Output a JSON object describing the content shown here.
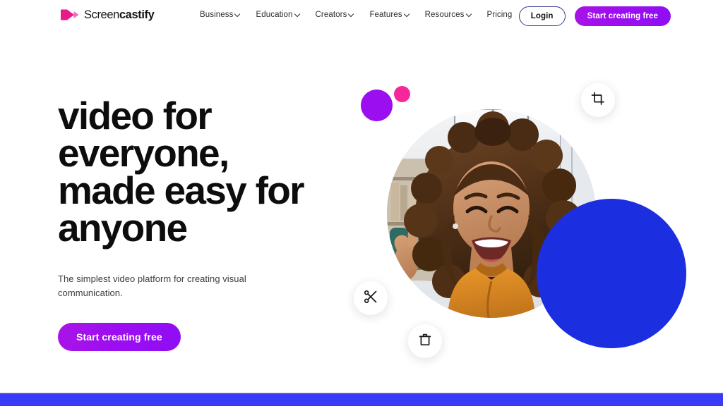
{
  "site": {
    "brand_name_light": "Screen",
    "brand_name_bold": "castify",
    "logo_icon": "play-logo-icon"
  },
  "header": {
    "nav_items": [
      {
        "label": "Business",
        "has_dropdown": true
      },
      {
        "label": "Education",
        "has_dropdown": true
      },
      {
        "label": "Creators",
        "has_dropdown": true
      },
      {
        "label": "Features",
        "has_dropdown": true
      },
      {
        "label": "Resources",
        "has_dropdown": true
      },
      {
        "label": "Pricing",
        "has_dropdown": false
      }
    ],
    "login_label": "Login",
    "cta_label": "Start creating free"
  },
  "hero": {
    "headline": "video for\neveryone,\nmade easy for\nanyone",
    "subhead": "The simplest video platform for creating visual communication.",
    "cta_label": "Start creating free"
  },
  "hero_visual": {
    "photo_alt": "Smiling woman with curly hair in an orange hoodie waving at the camera",
    "floating_buttons": [
      {
        "icon": "crop-icon"
      },
      {
        "icon": "scissors-icon"
      },
      {
        "icon": "trash-icon"
      }
    ],
    "decorations": [
      {
        "shape": "purple-circle"
      },
      {
        "shape": "pink-circle"
      },
      {
        "shape": "blue-circle"
      }
    ]
  },
  "colors": {
    "brand_pink": "#E8198B",
    "purple": "#9B0EF0",
    "pink_dot": "#F5279B",
    "blue_circle": "#1B2FE0",
    "bottom_bar": "#3B3BF5",
    "text_dark": "#0D0D0D",
    "login_border": "#3A3A8C"
  }
}
